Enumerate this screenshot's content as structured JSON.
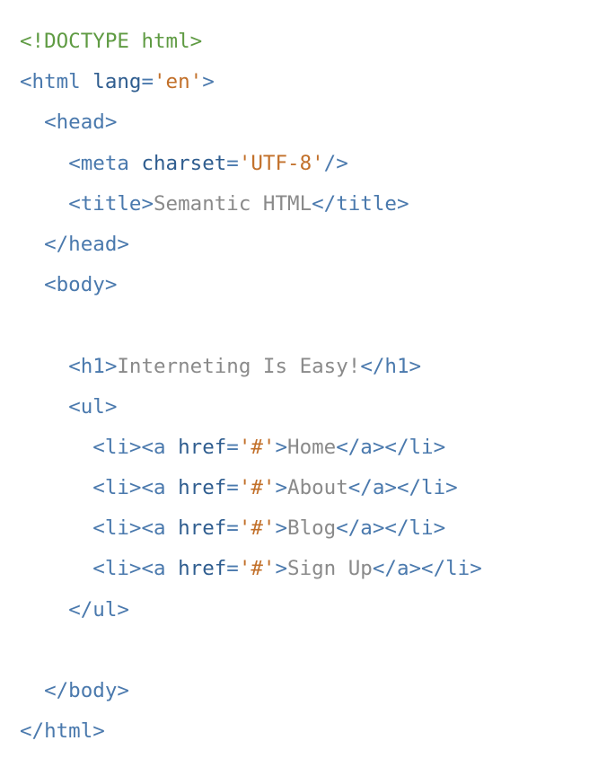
{
  "colors": {
    "doctype": "#5f9b43",
    "tag": "#4a79ad",
    "attribute": "#2f5d8f",
    "value": "#c2702a",
    "text": "#8a8a8a",
    "background": "#ffffff"
  },
  "code": {
    "lines": [
      [
        {
          "t": "doctype",
          "v": "<!DOCTYPE html>"
        }
      ],
      [
        {
          "t": "tag",
          "v": "<html"
        },
        {
          "t": "text",
          "v": " "
        },
        {
          "t": "attr",
          "v": "lang"
        },
        {
          "t": "punct",
          "v": "="
        },
        {
          "t": "value",
          "v": "'en'"
        },
        {
          "t": "tag",
          "v": ">"
        }
      ],
      [
        {
          "t": "text",
          "v": "  "
        },
        {
          "t": "tag",
          "v": "<head>"
        }
      ],
      [
        {
          "t": "text",
          "v": "    "
        },
        {
          "t": "tag",
          "v": "<meta"
        },
        {
          "t": "text",
          "v": " "
        },
        {
          "t": "attr",
          "v": "charset"
        },
        {
          "t": "punct",
          "v": "="
        },
        {
          "t": "value",
          "v": "'UTF-8'"
        },
        {
          "t": "tag",
          "v": "/>"
        }
      ],
      [
        {
          "t": "text",
          "v": "    "
        },
        {
          "t": "tag",
          "v": "<title>"
        },
        {
          "t": "text",
          "v": "Semantic HTML"
        },
        {
          "t": "tag",
          "v": "</title>"
        }
      ],
      [
        {
          "t": "text",
          "v": "  "
        },
        {
          "t": "tag",
          "v": "</head>"
        }
      ],
      [
        {
          "t": "text",
          "v": "  "
        },
        {
          "t": "tag",
          "v": "<body>"
        }
      ],
      [],
      [
        {
          "t": "text",
          "v": "    "
        },
        {
          "t": "tag",
          "v": "<h1>"
        },
        {
          "t": "text",
          "v": "Interneting Is Easy!"
        },
        {
          "t": "tag",
          "v": "</h1>"
        }
      ],
      [
        {
          "t": "text",
          "v": "    "
        },
        {
          "t": "tag",
          "v": "<ul>"
        }
      ],
      [
        {
          "t": "text",
          "v": "      "
        },
        {
          "t": "tag",
          "v": "<li><a"
        },
        {
          "t": "text",
          "v": " "
        },
        {
          "t": "attr",
          "v": "href"
        },
        {
          "t": "punct",
          "v": "="
        },
        {
          "t": "value",
          "v": "'#'"
        },
        {
          "t": "tag",
          "v": ">"
        },
        {
          "t": "text",
          "v": "Home"
        },
        {
          "t": "tag",
          "v": "</a></li>"
        }
      ],
      [
        {
          "t": "text",
          "v": "      "
        },
        {
          "t": "tag",
          "v": "<li><a"
        },
        {
          "t": "text",
          "v": " "
        },
        {
          "t": "attr",
          "v": "href"
        },
        {
          "t": "punct",
          "v": "="
        },
        {
          "t": "value",
          "v": "'#'"
        },
        {
          "t": "tag",
          "v": ">"
        },
        {
          "t": "text",
          "v": "About"
        },
        {
          "t": "tag",
          "v": "</a></li>"
        }
      ],
      [
        {
          "t": "text",
          "v": "      "
        },
        {
          "t": "tag",
          "v": "<li><a"
        },
        {
          "t": "text",
          "v": " "
        },
        {
          "t": "attr",
          "v": "href"
        },
        {
          "t": "punct",
          "v": "="
        },
        {
          "t": "value",
          "v": "'#'"
        },
        {
          "t": "tag",
          "v": ">"
        },
        {
          "t": "text",
          "v": "Blog"
        },
        {
          "t": "tag",
          "v": "</a></li>"
        }
      ],
      [
        {
          "t": "text",
          "v": "      "
        },
        {
          "t": "tag",
          "v": "<li><a"
        },
        {
          "t": "text",
          "v": " "
        },
        {
          "t": "attr",
          "v": "href"
        },
        {
          "t": "punct",
          "v": "="
        },
        {
          "t": "value",
          "v": "'#'"
        },
        {
          "t": "tag",
          "v": ">"
        },
        {
          "t": "text",
          "v": "Sign Up"
        },
        {
          "t": "tag",
          "v": "</a></li>"
        }
      ],
      [
        {
          "t": "text",
          "v": "    "
        },
        {
          "t": "tag",
          "v": "</ul>"
        }
      ],
      [],
      [
        {
          "t": "text",
          "v": "  "
        },
        {
          "t": "tag",
          "v": "</body>"
        }
      ],
      [
        {
          "t": "tag",
          "v": "</html>"
        }
      ]
    ]
  }
}
